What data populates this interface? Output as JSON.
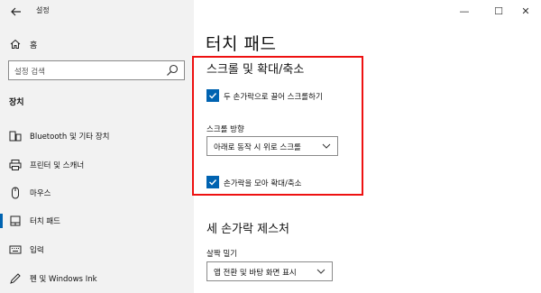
{
  "window": {
    "title": "설정",
    "minimize_glyph": "—",
    "maximize_glyph": "☐",
    "close_glyph": "✕"
  },
  "sidebar": {
    "back_icon": "back-arrow-icon",
    "home": {
      "label": "홈",
      "icon": "home-icon"
    },
    "search": {
      "placeholder": "설정 검색",
      "icon": "search-icon"
    },
    "section": "장치",
    "items": [
      {
        "label": "Bluetooth 및 기타 장치",
        "icon": "bluetooth-devices-icon"
      },
      {
        "label": "프린터 및 스캐너",
        "icon": "printer-icon"
      },
      {
        "label": "마우스",
        "icon": "mouse-icon"
      },
      {
        "label": "터치 패드",
        "icon": "touchpad-icon",
        "active": true
      },
      {
        "label": "입력",
        "icon": "keyboard-icon"
      },
      {
        "label": "펜 및 Windows Ink",
        "icon": "pen-icon"
      }
    ]
  },
  "main": {
    "title": "터치 패드",
    "scroll_zoom": {
      "heading": "스크롤 및 확대/축소",
      "two_finger_scroll": {
        "label": "두 손가락으로 끌어 스크롤하기",
        "checked": true
      },
      "scroll_direction": {
        "label": "스크롤 방향",
        "value": "아래로 동작 시 위로 스크롤"
      },
      "pinch_zoom": {
        "label": "손가락을 모아 확대/축소",
        "checked": true
      }
    },
    "three_finger": {
      "heading": "세 손가락 제스처",
      "swipe": {
        "label": "살짝 밀기",
        "value": "앱 전환 및 바탕 화면 표시"
      }
    }
  },
  "colors": {
    "accent": "#0063b1",
    "highlight": "#ee1111",
    "sidebar_bg": "#f2f2f2"
  }
}
